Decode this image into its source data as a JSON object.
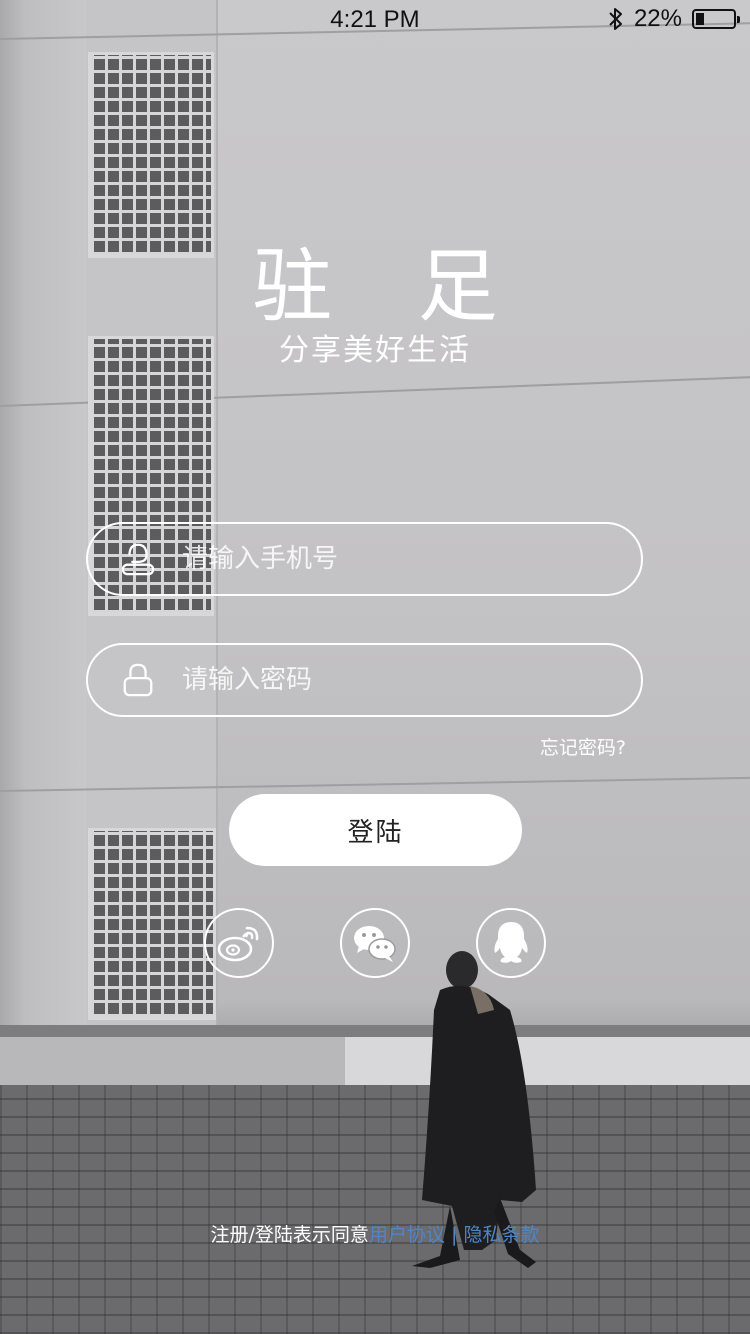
{
  "status_bar": {
    "time": "4:21 PM",
    "battery_text": "22%",
    "battery_level": 0.22,
    "bluetooth_icon": "bluetooth-icon"
  },
  "app": {
    "title": "驻 足",
    "subtitle": "分享美好生活"
  },
  "login_form": {
    "phone": {
      "placeholder": "请输入手机号",
      "value": "",
      "icon": "user-icon"
    },
    "password": {
      "placeholder": "请输入密码",
      "value": "",
      "icon": "lock-icon"
    },
    "forgot_password": "忘记密码?",
    "login_button": "登陆"
  },
  "social_login": [
    {
      "icon": "weibo-icon"
    },
    {
      "icon": "wechat-icon"
    },
    {
      "icon": "qq-icon"
    }
  ],
  "agreement": {
    "prefix": "注册/登陆表示同意",
    "user_agreement": "用户协议",
    "separator": " | ",
    "privacy_policy": "隐私条款"
  },
  "colors": {
    "text": "#ffffff",
    "link": "#4f86c6",
    "button_bg": "#ffffff",
    "button_text": "#222222"
  }
}
